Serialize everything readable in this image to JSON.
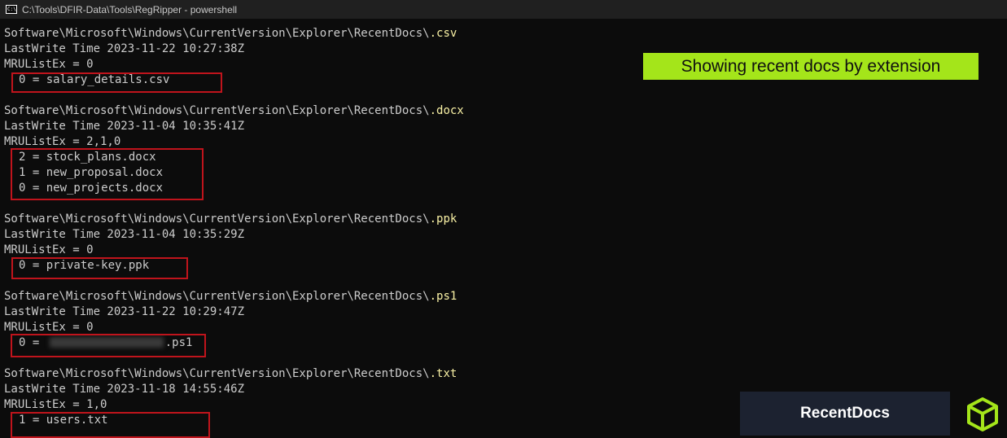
{
  "window": {
    "title": "C:\\Tools\\DFIR-Data\\Tools\\RegRipper - powershell",
    "icon": "powershell-console-icon"
  },
  "console": {
    "sections": [
      {
        "path": "Software\\Microsoft\\Windows\\CurrentVersion\\Explorer\\RecentDocs\\",
        "ext": ".csv",
        "lastwrite": "LastWrite Time 2023-11-22 10:27:38Z",
        "mrulist": "MRUListEx = 0",
        "entries": [
          "0 = salary_details.csv"
        ]
      },
      {
        "path": "Software\\Microsoft\\Windows\\CurrentVersion\\Explorer\\RecentDocs\\",
        "ext": ".docx",
        "lastwrite": "LastWrite Time 2023-11-04 10:35:41Z",
        "mrulist": "MRUListEx = 2,1,0",
        "entries": [
          "2 = stock_plans.docx",
          "1 = new_proposal.docx",
          "0 = new_projects.docx"
        ]
      },
      {
        "path": "Software\\Microsoft\\Windows\\CurrentVersion\\Explorer\\RecentDocs\\",
        "ext": ".ppk",
        "lastwrite": "LastWrite Time 2023-11-04 10:35:29Z",
        "mrulist": "MRUListEx = 0",
        "entries": [
          "0 = private-key.ppk"
        ]
      },
      {
        "path": "Software\\Microsoft\\Windows\\CurrentVersion\\Explorer\\RecentDocs\\",
        "ext": ".ps1",
        "lastwrite": "LastWrite Time 2023-11-22 10:29:47Z",
        "mrulist": "MRUListEx = 0",
        "entries": [
          {
            "prefix": "0 = ",
            "suffix": ".ps1"
          }
        ]
      },
      {
        "path": "Software\\Microsoft\\Windows\\CurrentVersion\\Explorer\\RecentDocs\\",
        "ext": ".txt",
        "lastwrite": "LastWrite Time 2023-11-18 14:55:46Z",
        "mrulist": "MRUListEx = 1,0",
        "entries": [
          "1 = users.txt"
        ]
      }
    ]
  },
  "overlay": {
    "banner": "Showing recent docs by extension",
    "badge": "RecentDocs",
    "logo_icon": "cube-logo-icon"
  },
  "colors": {
    "background": "#0c0c0c",
    "text": "#cccccc",
    "extension": "#f9f1a5",
    "highlight_box": "#c0141c",
    "banner_bg": "#a4e51a",
    "badge_bg": "#1c2230"
  }
}
